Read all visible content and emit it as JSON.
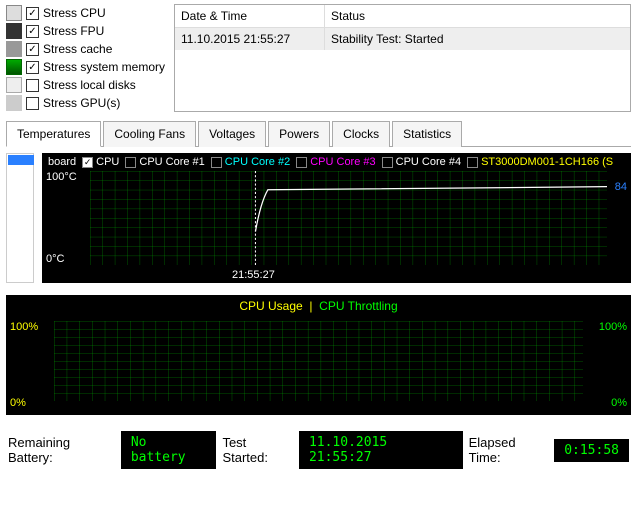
{
  "stress": {
    "items": [
      {
        "label": "Stress CPU",
        "checked": true,
        "iconColor": "#666"
      },
      {
        "label": "Stress FPU",
        "checked": true,
        "iconColor": "#333"
      },
      {
        "label": "Stress cache",
        "checked": true,
        "iconColor": "#888"
      },
      {
        "label": "Stress system memory",
        "checked": true,
        "iconColor": "#0a0"
      },
      {
        "label": "Stress local disks",
        "checked": false,
        "iconColor": "#aaa"
      },
      {
        "label": "Stress GPU(s)",
        "checked": false,
        "iconColor": "#ccc"
      }
    ]
  },
  "log": {
    "col1": "Date & Time",
    "col2": "Status",
    "rows": [
      {
        "datetime": "11.10.2015 21:55:27",
        "status": "Stability Test: Started"
      }
    ]
  },
  "tabs": [
    "Temperatures",
    "Cooling Fans",
    "Voltages",
    "Powers",
    "Clocks",
    "Statistics"
  ],
  "activeTab": 0,
  "chart1": {
    "legend": [
      {
        "label": "board",
        "color": "#fff",
        "checked": null
      },
      {
        "label": "CPU",
        "color": "#fff",
        "checked": true
      },
      {
        "label": "CPU Core #1",
        "color": "#fff",
        "checked": false
      },
      {
        "label": "CPU Core #2",
        "color": "#0ff",
        "checked": false
      },
      {
        "label": "CPU Core #3",
        "color": "#f0f",
        "checked": false
      },
      {
        "label": "CPU Core #4",
        "color": "#fff",
        "checked": false
      },
      {
        "label": "ST3000DM001-1CH166 (S",
        "color": "#ff0",
        "checked": false
      }
    ],
    "yTop": "100°C",
    "yBot": "0°C",
    "xTick": "21:55:27",
    "current": "84",
    "currentColor": "#2a80ff"
  },
  "chart2": {
    "title_a": "CPU Usage",
    "title_b": "CPU Throttling",
    "yTopL": "100%",
    "yBotL": "0%",
    "yTopR": "100%",
    "yBotR": "0%"
  },
  "status": {
    "battery_label": "Remaining Battery:",
    "battery_val": "No battery",
    "started_label": "Test Started:",
    "started_val": "11.10.2015 21:55:27",
    "elapsed_label": "Elapsed Time:",
    "elapsed_val": "0:15:58"
  },
  "chart_data": [
    {
      "type": "line",
      "title": "Temperatures – CPU",
      "ylabel": "°C",
      "ylim": [
        0,
        100
      ],
      "x_event": "21:55:27",
      "series": [
        {
          "name": "CPU",
          "baseline_before_event": 35,
          "plateau_after_event": 84
        }
      ]
    },
    {
      "type": "line",
      "title": "CPU Usage | CPU Throttling",
      "ylabel": "%",
      "ylim": [
        0,
        100
      ],
      "series": [
        {
          "name": "CPU Usage",
          "values": []
        },
        {
          "name": "CPU Throttling",
          "values": []
        }
      ]
    }
  ]
}
